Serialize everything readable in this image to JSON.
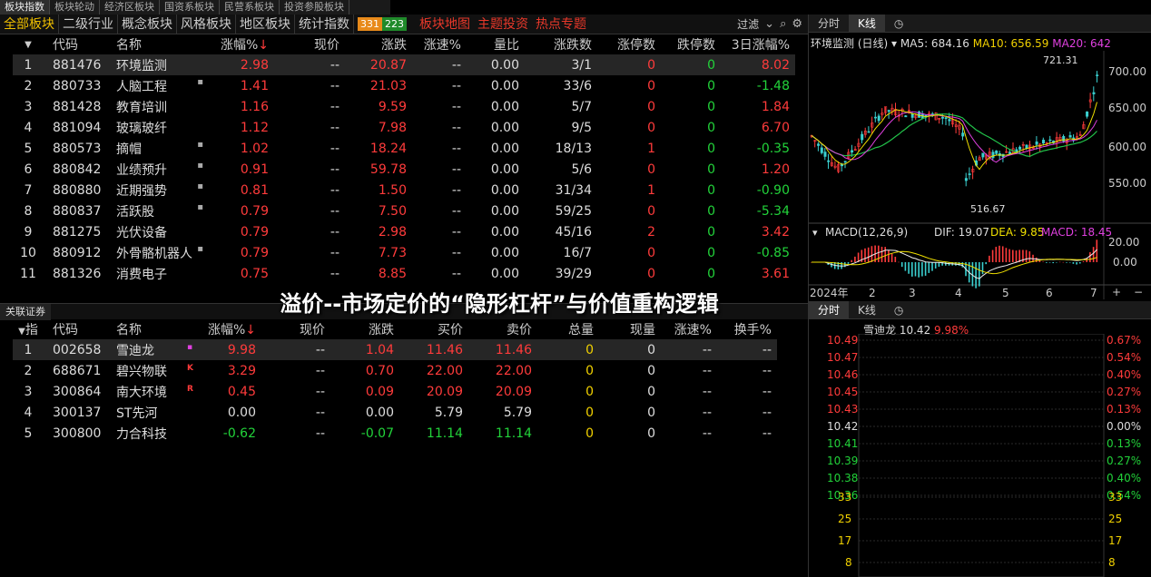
{
  "top_tabs": [
    "板块指数",
    "板块轮动",
    "经济区板块",
    "国资系板块",
    "民营系板块",
    "投资参股板块"
  ],
  "sub_tabs": [
    "全部板块",
    "二级行业",
    "概念板块",
    "风格板块",
    "地区板块",
    "统计指数"
  ],
  "up_count": "331",
  "down_count": "223",
  "red_tabs": [
    "板块地图",
    "主题投资",
    "热点专题"
  ],
  "filter_label": "过滤",
  "sector_columns": [
    "代码",
    "名称",
    "涨幅%",
    "现价",
    "涨跌",
    "涨速%",
    "量比",
    "涨跌数",
    "涨停数",
    "跌停数",
    "3日涨幅%"
  ],
  "sectors": [
    {
      "no": "1",
      "code": "881476",
      "name": "环境监测",
      "mark": "",
      "pct": "2.98",
      "price": "--",
      "chg": "20.87",
      "speed": "--",
      "vr": "0.00",
      "updown": "3/1",
      "zt": "0",
      "dt": "0",
      "d3": "8.02",
      "d3c": "r"
    },
    {
      "no": "2",
      "code": "880733",
      "name": "人脑工程",
      "mark": "▪",
      "pct": "1.41",
      "price": "--",
      "chg": "21.03",
      "speed": "--",
      "vr": "0.00",
      "updown": "33/6",
      "zt": "0",
      "dt": "0",
      "d3": "-1.48",
      "d3c": "g"
    },
    {
      "no": "3",
      "code": "881428",
      "name": "教育培训",
      "mark": "",
      "pct": "1.16",
      "price": "--",
      "chg": "9.59",
      "speed": "--",
      "vr": "0.00",
      "updown": "5/7",
      "zt": "0",
      "dt": "0",
      "d3": "1.84",
      "d3c": "r"
    },
    {
      "no": "4",
      "code": "881094",
      "name": "玻璃玻纤",
      "mark": "",
      "pct": "1.12",
      "price": "--",
      "chg": "7.98",
      "speed": "--",
      "vr": "0.00",
      "updown": "9/5",
      "zt": "0",
      "dt": "0",
      "d3": "6.70",
      "d3c": "r"
    },
    {
      "no": "5",
      "code": "880573",
      "name": "摘帽",
      "mark": "▪",
      "pct": "1.02",
      "price": "--",
      "chg": "18.24",
      "speed": "--",
      "vr": "0.00",
      "updown": "18/13",
      "zt": "1",
      "dt": "0",
      "d3": "-0.35",
      "d3c": "g"
    },
    {
      "no": "6",
      "code": "880842",
      "name": "业绩预升",
      "mark": "▪",
      "pct": "0.91",
      "price": "--",
      "chg": "59.78",
      "speed": "--",
      "vr": "0.00",
      "updown": "5/6",
      "zt": "0",
      "dt": "0",
      "d3": "1.20",
      "d3c": "r"
    },
    {
      "no": "7",
      "code": "880880",
      "name": "近期强势",
      "mark": "▪",
      "pct": "0.81",
      "price": "--",
      "chg": "1.50",
      "speed": "--",
      "vr": "0.00",
      "updown": "31/34",
      "zt": "1",
      "dt": "0",
      "d3": "-0.90",
      "d3c": "g"
    },
    {
      "no": "8",
      "code": "880837",
      "name": "活跃股",
      "mark": "▪",
      "pct": "0.79",
      "price": "--",
      "chg": "7.50",
      "speed": "--",
      "vr": "0.00",
      "updown": "59/25",
      "zt": "0",
      "dt": "0",
      "d3": "-5.34",
      "d3c": "g"
    },
    {
      "no": "9",
      "code": "881275",
      "name": "光伏设备",
      "mark": "",
      "pct": "0.79",
      "price": "--",
      "chg": "2.98",
      "speed": "--",
      "vr": "0.00",
      "updown": "45/16",
      "zt": "2",
      "dt": "0",
      "d3": "3.42",
      "d3c": "r"
    },
    {
      "no": "10",
      "code": "880912",
      "name": "外骨骼机器人",
      "mark": "▪",
      "pct": "0.79",
      "price": "--",
      "chg": "7.73",
      "speed": "--",
      "vr": "0.00",
      "updown": "16/7",
      "zt": "0",
      "dt": "0",
      "d3": "-0.85",
      "d3c": "g"
    },
    {
      "no": "11",
      "code": "881326",
      "name": "消费电子",
      "mark": "",
      "pct": "0.75",
      "price": "--",
      "chg": "8.85",
      "speed": "--",
      "vr": "0.00",
      "updown": "39/29",
      "zt": "0",
      "dt": "0",
      "d3": "3.61",
      "d3c": "r"
    }
  ],
  "related_tab": "关联证券",
  "overlay_title": "溢价--市场定价的“隐形杠杆”与价值重构逻辑",
  "stock_columns": [
    "指",
    "代码",
    "名称",
    "涨幅%",
    "现价",
    "涨跌",
    "买价",
    "卖价",
    "总量",
    "现量",
    "涨速%",
    "换手%"
  ],
  "stocks": [
    {
      "no": "1",
      "code": "002658",
      "name": "雪迪龙",
      "mark": "▪",
      "mc": "#e040e0",
      "pct": "9.98",
      "pc": "r",
      "price": "--",
      "chg": "1.04",
      "cc": "r",
      "buy": "11.46",
      "bc": "r",
      "sell": "11.46",
      "sc": "r",
      "vol": "0",
      "cur": "0",
      "speed": "--",
      "turn": "--"
    },
    {
      "no": "2",
      "code": "688671",
      "name": "碧兴物联",
      "mark": "K",
      "mc": "#ff3b3b",
      "pct": "3.29",
      "pc": "r",
      "price": "--",
      "chg": "0.70",
      "cc": "r",
      "buy": "22.00",
      "bc": "r",
      "sell": "22.00",
      "sc": "r",
      "vol": "0",
      "cur": "0",
      "speed": "--",
      "turn": "--"
    },
    {
      "no": "3",
      "code": "300864",
      "name": "南大环境",
      "mark": "R",
      "mc": "#ff3b3b",
      "pct": "0.45",
      "pc": "r",
      "price": "--",
      "chg": "0.09",
      "cc": "r",
      "buy": "20.09",
      "bc": "r",
      "sell": "20.09",
      "sc": "r",
      "vol": "0",
      "cur": "0",
      "speed": "--",
      "turn": "--"
    },
    {
      "no": "4",
      "code": "300137",
      "name": "ST先河",
      "mark": "",
      "mc": "",
      "pct": "0.00",
      "pc": "w",
      "price": "--",
      "chg": "0.00",
      "cc": "w",
      "buy": "5.79",
      "bc": "w",
      "sell": "5.79",
      "sc": "w",
      "vol": "0",
      "cur": "0",
      "speed": "--",
      "turn": "--"
    },
    {
      "no": "5",
      "code": "300800",
      "name": "力合科技",
      "mark": "",
      "mc": "",
      "pct": "-0.62",
      "pc": "g",
      "price": "--",
      "chg": "-0.07",
      "cc": "g",
      "buy": "11.14",
      "bc": "g",
      "sell": "11.14",
      "sc": "g",
      "vol": "0",
      "cur": "0",
      "speed": "--",
      "turn": "--"
    }
  ],
  "kline": {
    "tabs": [
      "分时",
      "K线"
    ],
    "name_label": "环境监测 (日线)",
    "ma5": "MA5: 684.16",
    "ma10": "MA10: 656.59",
    "ma20": "MA20: 642",
    "high_label": "721.31",
    "low_label": "516.67",
    "y_ticks": [
      "700.00",
      "650.00",
      "600.00",
      "550.00"
    ],
    "macd_label": "MACD(12,26,9)",
    "dif": "DIF: 19.07",
    "dea": "DEA: 9.85",
    "macd": "MACD: 18.45",
    "macd_ticks": [
      "20.00",
      "0.00"
    ],
    "x_labels": [
      "2024年",
      "2",
      "3",
      "4",
      "5",
      "6",
      "7"
    ]
  },
  "intraday": {
    "tabs": [
      "分时",
      "K线"
    ],
    "name": "雪迪龙",
    "price": "10.42",
    "pct": "9.98%",
    "left_prices": [
      "10.49",
      "10.47",
      "10.46",
      "10.45",
      "10.43",
      "10.42",
      "10.41",
      "10.39",
      "10.38",
      "10.36"
    ],
    "right_pcts": [
      "0.67%",
      "0.54%",
      "0.40%",
      "0.27%",
      "0.13%",
      "0.00%",
      "0.13%",
      "0.27%",
      "0.40%",
      "0.54%"
    ],
    "vol_ticks": [
      "33",
      "25",
      "17",
      "8"
    ]
  },
  "colors": {
    "up": "#ff3b3b",
    "down": "#22d33a",
    "accent": "#f0c000",
    "bg": "#000000"
  }
}
